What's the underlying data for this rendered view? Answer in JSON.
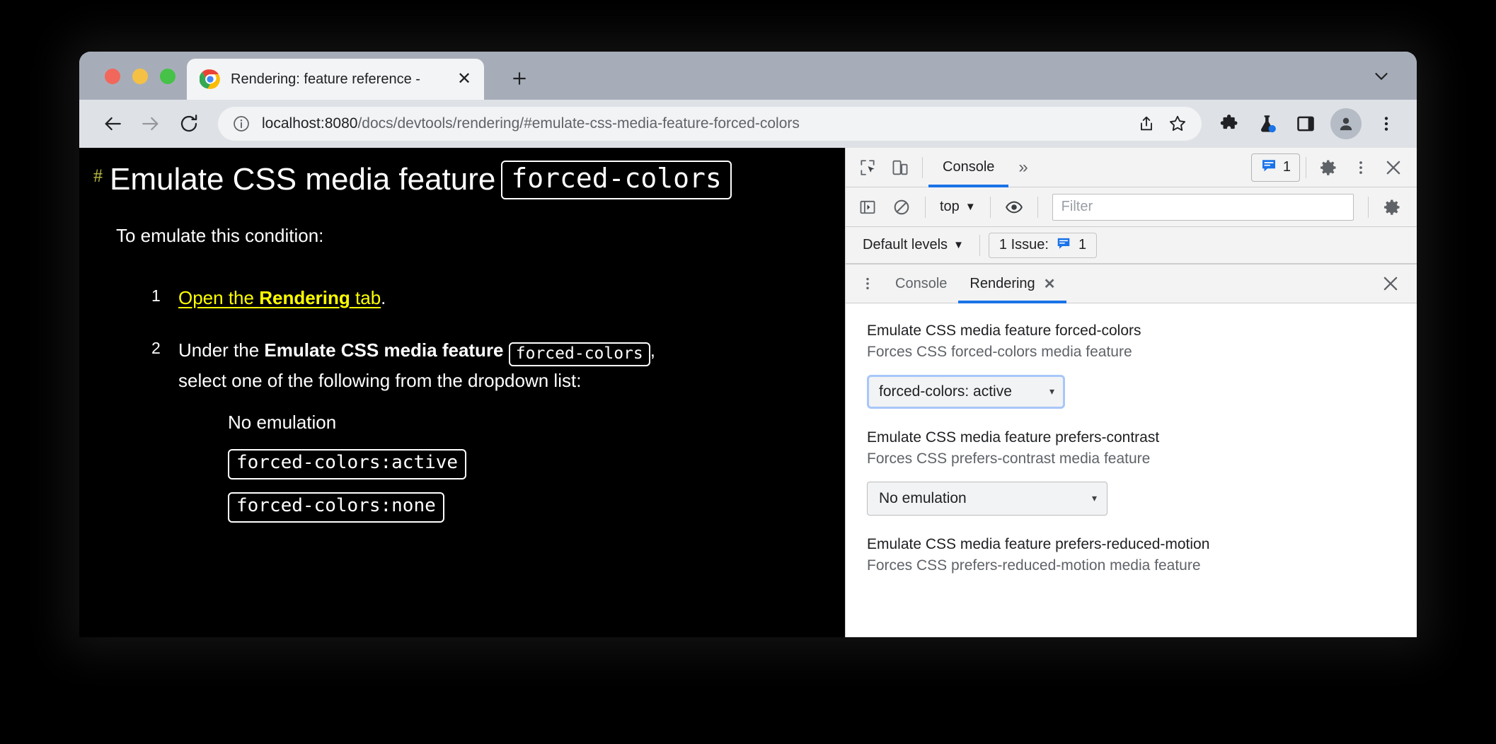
{
  "browser": {
    "traffic_lights": [
      "close",
      "minimize",
      "maximize"
    ],
    "tab": {
      "title": "Rendering: feature reference -",
      "favicon": "chrome-logo-icon",
      "close_label": "✕"
    },
    "new_tab_label": "+",
    "window_chevron": "chevron-down-icon",
    "toolbar": {
      "back": "←",
      "forward": "→",
      "reload": "↻",
      "site_info": "info-circle-icon",
      "url_host": "localhost:8080",
      "url_path": "/docs/devtools/rendering/#emulate-css-media-feature-forced-colors",
      "share": "share-icon",
      "bookmark": "star-icon",
      "extensions": "puzzle-icon",
      "experiments": "flask-icon",
      "side_panel": "side-panel-icon",
      "profile": "avatar-icon",
      "menu": "three-dot-menu-icon"
    }
  },
  "page": {
    "anchor": "#",
    "title": "Emulate CSS media feature",
    "title_code": "forced-colors",
    "intro": "To emulate this condition:",
    "steps": [
      {
        "num": "1",
        "link_prefix": "Open the ",
        "link_bold": "Rendering",
        "link_suffix": " tab",
        "tail": "."
      },
      {
        "num": "2",
        "line1_prefix": "Under the ",
        "line1_bold": "Emulate CSS media feature",
        "line1_code": "forced-colors",
        "line1_tail": ",",
        "line2": "select one of the following from the dropdown list:",
        "options": [
          {
            "text": "No emulation",
            "code": false
          },
          {
            "text": "forced-colors:active",
            "code": true
          },
          {
            "text": "forced-colors:none",
            "code": true
          }
        ]
      }
    ]
  },
  "devtools": {
    "main_tabbar": {
      "inspect_icon": "inspect-element-icon",
      "device_icon": "device-toolbar-icon",
      "tabs": [
        {
          "label": "Console",
          "active": true
        }
      ],
      "overflow": "»",
      "issues_count": "1",
      "issues_icon": "issue-message-icon",
      "settings_icon": "gear-icon",
      "more_icon": "three-dot-menu-icon",
      "close_icon": "close-icon"
    },
    "console_toolbar": {
      "sidebar_icon": "console-sidebar-icon",
      "clear_icon": "clear-console-icon",
      "context": "top",
      "context_caret": "▼",
      "eye_icon": "live-expression-icon",
      "filter_placeholder": "Filter",
      "settings_icon": "gear-icon"
    },
    "levels_bar": {
      "levels_label": "Default levels",
      "levels_caret": "▼",
      "issue_label": "1 Issue:",
      "issue_icon": "issue-message-icon",
      "issue_count": "1"
    },
    "drawer_tabbar": {
      "more_icon": "three-dot-menu-icon",
      "tabs": [
        {
          "label": "Console",
          "active": false,
          "closable": false
        },
        {
          "label": "Rendering",
          "active": true,
          "closable": true,
          "close_label": "✕"
        }
      ],
      "close_icon": "close-icon"
    },
    "rendering": [
      {
        "title": "Emulate CSS media feature forced-colors",
        "subtitle": "Forces CSS forced-colors media feature",
        "select_value": "forced-colors: active",
        "focused": true,
        "caret": "▾"
      },
      {
        "title": "Emulate CSS media feature prefers-contrast",
        "subtitle": "Forces CSS prefers-contrast media feature",
        "select_value": "No emulation",
        "focused": false,
        "caret": "▾"
      },
      {
        "title": "Emulate CSS media feature prefers-reduced-motion",
        "subtitle": "Forces CSS prefers-reduced-motion media feature",
        "select_value": null,
        "focused": false,
        "caret": "▾"
      }
    ]
  },
  "colors": {
    "accent_blue": "#1a73e8",
    "focus_ring": "#a8c7fa",
    "link_yellow": "#ffff00",
    "anchor_olive": "#b8b840",
    "tabstrip": "#a7adb8",
    "toolbar": "#dee1e6"
  }
}
